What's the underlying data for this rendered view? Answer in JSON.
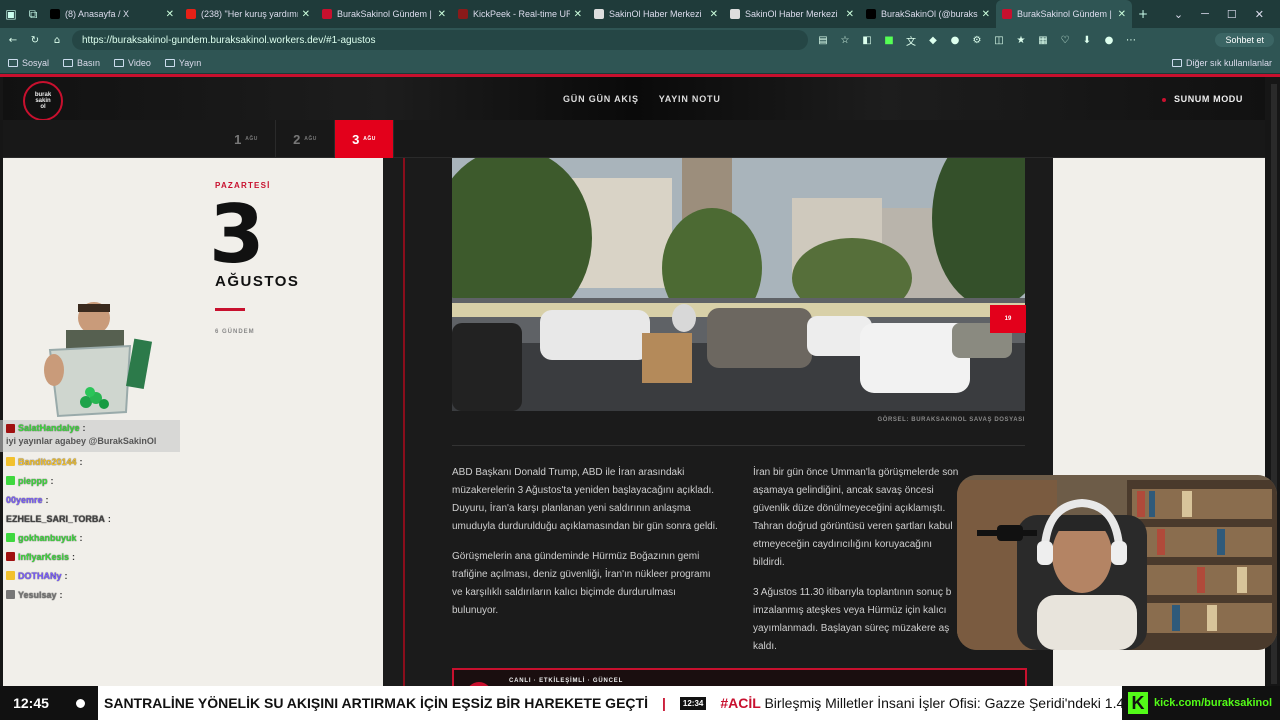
{
  "browser": {
    "tabs": [
      {
        "label": "(8) Anasayfa / X",
        "icon": "x-icon",
        "color": "#000000",
        "active": false
      },
      {
        "label": "(238) \"Her kuruş yardımın h",
        "icon": "youtube-icon",
        "color": "#e62117",
        "active": false
      },
      {
        "label": "BurakSakinol Gündem | Son",
        "icon": "site-icon",
        "color": "#c8102e",
        "active": false
      },
      {
        "label": "KickPeek - Real-time URL C",
        "icon": "kickpeek-icon",
        "color": "#8a1a1a",
        "active": false
      },
      {
        "label": "SakinOl Haber Merkezi",
        "icon": "globe-icon",
        "color": "#dddddd",
        "active": false
      },
      {
        "label": "SakinOl Haber Merkezi",
        "icon": "globe-icon",
        "color": "#dddddd",
        "active": false
      },
      {
        "label": "BurakSakinOl (@buraks",
        "icon": "x-icon",
        "color": "#000000",
        "active": false
      },
      {
        "label": "BurakSakinol Gündem | Son",
        "icon": "site-icon",
        "color": "#c8102e",
        "active": true
      }
    ],
    "url": "https://buraksakinol-gundem.buraksakinol.workers.dev/#1-agustos",
    "sohbet_label": "Sohbet et",
    "bookmarks": [
      "Sosyal",
      "Basın",
      "Video",
      "Yayın"
    ],
    "bookmarks_other": "Diğer sık kullanılanlar"
  },
  "site": {
    "nav": [
      "GÜN GÜN AKIŞ",
      "YAYIN NOTU"
    ],
    "present_mode": "SUNUM MODU",
    "day_tabs": [
      {
        "num": "1",
        "month": "AĞU",
        "active": false
      },
      {
        "num": "2",
        "month": "AĞU",
        "active": false
      },
      {
        "num": "3",
        "month": "AĞU",
        "active": true
      }
    ],
    "day": {
      "weekday": "PAZARTESİ",
      "number": "3",
      "month": "AĞUSTOS",
      "count": "6 GÜNDEM"
    },
    "image_counter": "19",
    "caption": "GÖRSEL: BURAKSAKINOL SAVAŞ DOSYASI",
    "col1": [
      "ABD Başkanı Donald Trump, ABD ile İran arasındaki müzakerelerin 3 Ağustos'ta yeniden başlayacağını açıkladı. Duyuru, İran'a karşı planlanan yeni saldırının anlaşma umuduyla durdurulduğu açıklamasından bir gün sonra geldi.",
      "Görüşmelerin ana gündeminde Hürmüz Boğazının gemi trafiğine açılması, deniz güvenliği, İran'ın nükleer programı ve karşılıklı saldırıların kalıcı biçimde durdurulması bulunuyor."
    ],
    "col2": [
      "İran bir gün önce Umman'la görüşmelerde son aşamaya gelindiğini, ancak savaş öncesi güvenlik düze dönülmeyeceğini açıklamıştı. Tahran doğrud görüntüsü veren şartları kabul etmeyeceğin caydırıcılığını koruyacağını bildirdi.",
      "3 Ağustos 11.30 itibarıyla toplantının sonuç b imzalanmış ateşkes veya Hürmüz için kalıcı yayımlanmadı. Başlayan süreç müzakere aş kaldı."
    ],
    "live_label": "CANLI · ETKİLEŞİMLİ · GÜNCEL"
  },
  "chat": [
    {
      "user": "SalatHandalye",
      "msg": "iyi yayınlar agabey @BurakSakinOl",
      "color": "#3fd83f",
      "badge": "#a01010"
    },
    {
      "user": "Bandito20144",
      "msg": "",
      "color": "#f2c12e",
      "badge": "#f2c12e"
    },
    {
      "user": "pieppp",
      "msg": "",
      "color": "#3fd83f",
      "badge": "#3fd83f"
    },
    {
      "user": "00yemre",
      "msg": "",
      "color": "#7a5cff",
      "badge": ""
    },
    {
      "user": "EZHELE_SARI_TORBA",
      "msg": "",
      "color": "#444444",
      "badge": ""
    },
    {
      "user": "gokhanbuyuk",
      "msg": "",
      "color": "#3fd83f",
      "badge": "#3fd83f"
    },
    {
      "user": "InflyarKesis",
      "msg": "",
      "color": "#3fd83f",
      "badge": "#a01010"
    },
    {
      "user": "DOTHANy",
      "msg": "",
      "color": "#7a5cff",
      "badge": "#f2c12e"
    },
    {
      "user": "Yesulsay",
      "msg": "",
      "color": "#777777",
      "badge": "#777777"
    }
  ],
  "ticker": {
    "time": "12:45",
    "headline": "SANTRALİNE YÖNELİK SU AKIŞINI ARTIRMAK İÇİN EŞSİZ BİR HAREKETE GEÇTİ",
    "sep": "|",
    "timestamp": "12:34",
    "tag": "#ACİL",
    "next": "Birleşmiş Milletler İnsani İşler Ofisi: Gazze Şeridi'ndeki 1.4",
    "channel": "kick.com/buraksakinol"
  }
}
